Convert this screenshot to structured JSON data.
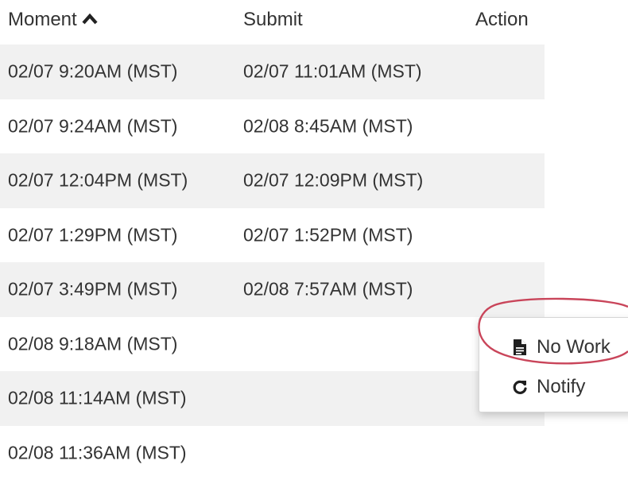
{
  "table": {
    "headers": {
      "moment": "Moment",
      "submit": "Submit",
      "action": "Action"
    },
    "rows": [
      {
        "moment": "02/07 9:20AM (MST)",
        "submit": "02/07 11:01AM (MST)"
      },
      {
        "moment": "02/07 9:24AM (MST)",
        "submit": "02/08 8:45AM (MST)"
      },
      {
        "moment": "02/07 12:04PM (MST)",
        "submit": "02/07 12:09PM (MST)"
      },
      {
        "moment": "02/07 1:29PM (MST)",
        "submit": "02/07 1:52PM (MST)"
      },
      {
        "moment": "02/07 3:49PM (MST)",
        "submit": "02/08 7:57AM (MST)"
      },
      {
        "moment": "02/08 9:18AM (MST)",
        "submit": ""
      },
      {
        "moment": "02/08 11:14AM (MST)",
        "submit": ""
      },
      {
        "moment": "02/08 11:36AM (MST)",
        "submit": ""
      }
    ]
  },
  "action_menu": {
    "items": [
      {
        "label": "No Work",
        "icon": "file-icon"
      },
      {
        "label": "Notify",
        "icon": "refresh-icon"
      }
    ]
  },
  "colors": {
    "text": "#333333",
    "row_stripe": "#f1f1f1",
    "gear": "#3b6b9a",
    "annotation_ring": "#c9455a"
  }
}
